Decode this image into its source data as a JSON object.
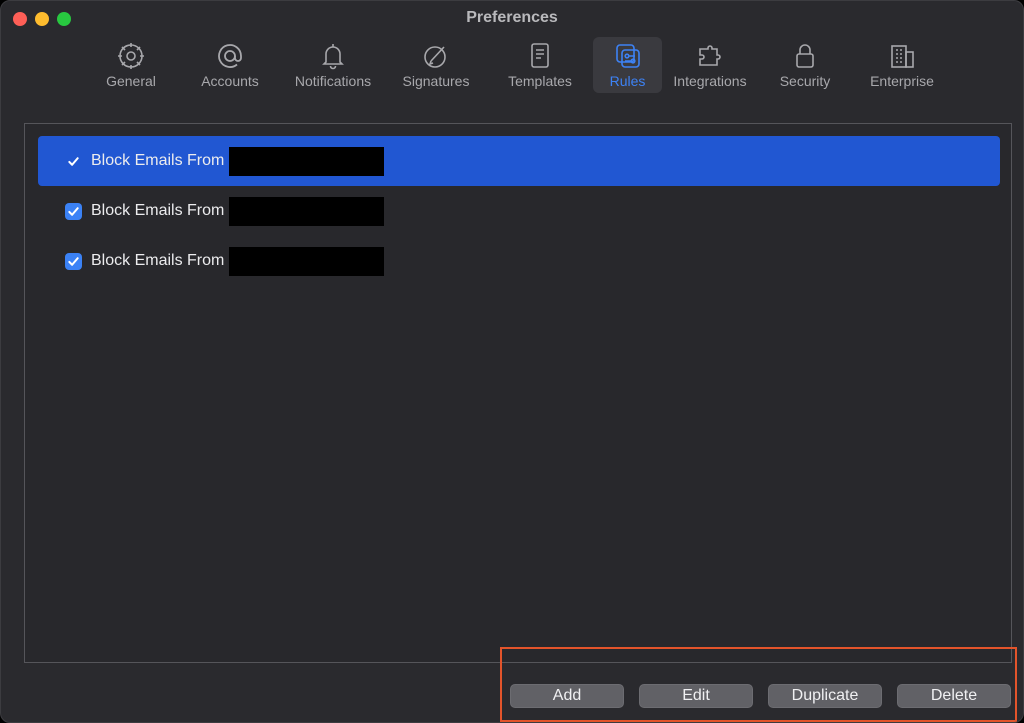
{
  "window": {
    "title": "Preferences"
  },
  "tabs": [
    {
      "label": "General",
      "icon": "gear-icon"
    },
    {
      "label": "Accounts",
      "icon": "at-icon"
    },
    {
      "label": "Notifications",
      "icon": "bell-icon"
    },
    {
      "label": "Signatures",
      "icon": "signature-icon"
    },
    {
      "label": "Templates",
      "icon": "document-icon"
    },
    {
      "label": "Rules",
      "icon": "rules-icon",
      "active": true
    },
    {
      "label": "Integrations",
      "icon": "puzzle-icon"
    },
    {
      "label": "Security",
      "icon": "lock-icon"
    },
    {
      "label": "Enterprise",
      "icon": "building-icon"
    }
  ],
  "rules": [
    {
      "label": "Block Emails From",
      "checked": true,
      "selected": true
    },
    {
      "label": "Block Emails From",
      "checked": true,
      "selected": false
    },
    {
      "label": "Block Emails From",
      "checked": true,
      "selected": false
    }
  ],
  "buttons": {
    "add": "Add",
    "edit": "Edit",
    "duplicate": "Duplicate",
    "delete": "Delete"
  },
  "colors": {
    "accent": "#3d82f5",
    "selection": "#2157d2",
    "highlight_box": "#e3542b"
  }
}
